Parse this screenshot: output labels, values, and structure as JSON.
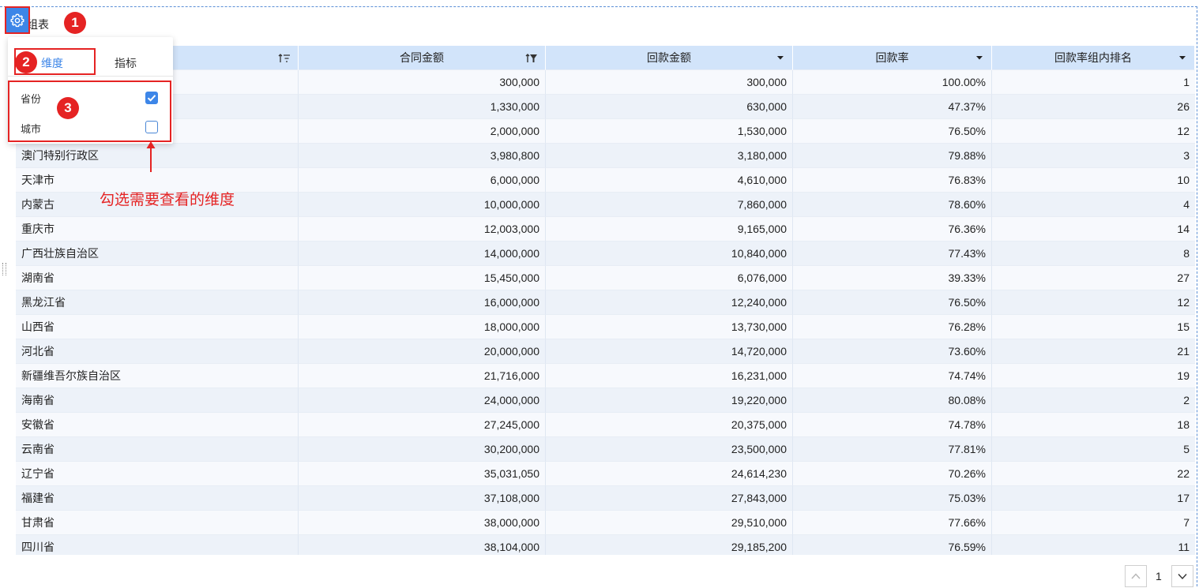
{
  "widget": {
    "title": "组表"
  },
  "table": {
    "columns": [
      {
        "label": "",
        "sort": "asc-filter"
      },
      {
        "label": "合同金额",
        "sort": "asc-desc-filter"
      },
      {
        "label": "回款金额",
        "sort": "dropdown"
      },
      {
        "label": "回款率",
        "sort": "dropdown"
      },
      {
        "label": "回款率组内排名",
        "sort": "dropdown"
      }
    ],
    "rows": [
      {
        "name": "",
        "contract": "300,000",
        "received": "300,000",
        "rate": "100.00%",
        "rank": "1"
      },
      {
        "name": "",
        "contract": "1,330,000",
        "received": "630,000",
        "rate": "47.37%",
        "rank": "26"
      },
      {
        "name": "",
        "contract": "2,000,000",
        "received": "1,530,000",
        "rate": "76.50%",
        "rank": "12"
      },
      {
        "name": "澳门特别行政区",
        "contract": "3,980,800",
        "received": "3,180,000",
        "rate": "79.88%",
        "rank": "3"
      },
      {
        "name": "天津市",
        "contract": "6,000,000",
        "received": "4,610,000",
        "rate": "76.83%",
        "rank": "10"
      },
      {
        "name": "内蒙古",
        "contract": "10,000,000",
        "received": "7,860,000",
        "rate": "78.60%",
        "rank": "4"
      },
      {
        "name": "重庆市",
        "contract": "12,003,000",
        "received": "9,165,000",
        "rate": "76.36%",
        "rank": "14"
      },
      {
        "name": "广西壮族自治区",
        "contract": "14,000,000",
        "received": "10,840,000",
        "rate": "77.43%",
        "rank": "8"
      },
      {
        "name": "湖南省",
        "contract": "15,450,000",
        "received": "6,076,000",
        "rate": "39.33%",
        "rank": "27"
      },
      {
        "name": "黑龙江省",
        "contract": "16,000,000",
        "received": "12,240,000",
        "rate": "76.50%",
        "rank": "12"
      },
      {
        "name": "山西省",
        "contract": "18,000,000",
        "received": "13,730,000",
        "rate": "76.28%",
        "rank": "15"
      },
      {
        "name": "河北省",
        "contract": "20,000,000",
        "received": "14,720,000",
        "rate": "73.60%",
        "rank": "21"
      },
      {
        "name": "新疆维吾尔族自治区",
        "contract": "21,716,000",
        "received": "16,231,000",
        "rate": "74.74%",
        "rank": "19"
      },
      {
        "name": "海南省",
        "contract": "24,000,000",
        "received": "19,220,000",
        "rate": "80.08%",
        "rank": "2"
      },
      {
        "name": "安徽省",
        "contract": "27,245,000",
        "received": "20,375,000",
        "rate": "74.78%",
        "rank": "18"
      },
      {
        "name": "云南省",
        "contract": "30,200,000",
        "received": "23,500,000",
        "rate": "77.81%",
        "rank": "5"
      },
      {
        "name": "辽宁省",
        "contract": "35,031,050",
        "received": "24,614,230",
        "rate": "70.26%",
        "rank": "22"
      },
      {
        "name": "福建省",
        "contract": "37,108,000",
        "received": "27,843,000",
        "rate": "75.03%",
        "rank": "17"
      },
      {
        "name": "甘肃省",
        "contract": "38,000,000",
        "received": "29,510,000",
        "rate": "77.66%",
        "rank": "7"
      },
      {
        "name": "四川省",
        "contract": "38,104,000",
        "received": "29,185,200",
        "rate": "76.59%",
        "rank": "11"
      }
    ]
  },
  "popover": {
    "tabs": [
      "维度",
      "指标"
    ],
    "active_tab": "维度",
    "options": [
      {
        "label": "省份",
        "checked": true
      },
      {
        "label": "城市",
        "checked": false
      }
    ]
  },
  "annotations": {
    "badges": [
      "1",
      "2",
      "3"
    ],
    "note": "勾选需要查看的维度",
    "color": "#e52323"
  },
  "pagination": {
    "page": "1"
  },
  "colors": {
    "accent": "#3d86e8",
    "header_bg": "#d2e4fa",
    "row_odd": "#edf2f9",
    "row_even": "#f7f9fd"
  },
  "icons": {
    "settings": "gear-icon",
    "prev": "chevron-up-icon",
    "next": "chevron-down-icon"
  }
}
